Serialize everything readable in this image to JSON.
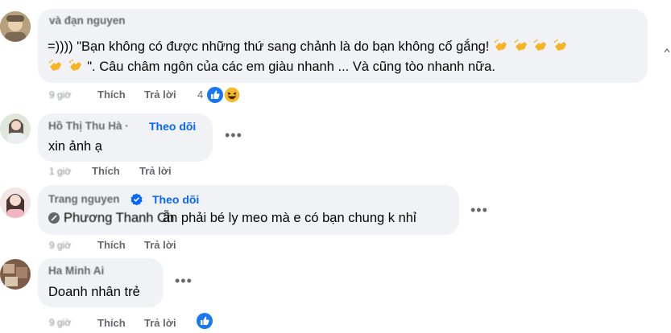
{
  "comments": [
    {
      "author": "và đạn nguyen",
      "text_line1": "=)))) \"Bạn không có được những thứ sang chảnh là do bạn không cố gắng!",
      "text_line2": "\". Câu châm ngôn của các em giàu nhanh ... Và cũng tòo nhanh nữa.",
      "time": "9 giờ",
      "like": "Thích",
      "reply": "Trả lời",
      "reaction_count": "4"
    },
    {
      "author": "Hồ Thị Thu Hà ·",
      "follow": "Theo dõi",
      "text": "xin ảnh ạ",
      "time": "1 giờ",
      "like": "Thích",
      "reply": "Trả lời"
    },
    {
      "author": "Trang nguyen",
      "follow": "Theo dõi",
      "tag": "Phương Thanh Ch",
      "text": "ẫn phải bé ly meo mà e có bạn chung k nhỉ",
      "time": "9 giờ",
      "like": "Thích",
      "reply": "Trả lời"
    },
    {
      "author": "Ha Minh Ai",
      "text": "Doanh nhân trẻ",
      "time": "9 giờ",
      "like": "Thích",
      "reply": "Trả lời"
    }
  ],
  "colors": {
    "bubble": "#f0f2f5",
    "follow": "#0866ff",
    "like_reaction": "#1877f2",
    "haha_reaction": "#f7b928",
    "secondary_text": "#65676b"
  },
  "icons": {
    "more": "more-horizontal-icon",
    "like": "like-reaction-icon",
    "haha": "haha-reaction-icon",
    "verified": "verified-badge-icon",
    "clap": "clapping-hands-emoji"
  },
  "more_label": "•••"
}
